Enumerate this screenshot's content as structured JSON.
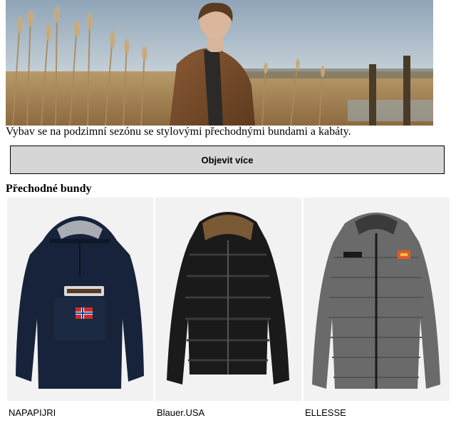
{
  "hero": {
    "image": "hero-photo-man-in-shearling-coat-in-reeds",
    "text": "Vybav se na podzimní sezónu se stylovými přechodnými bundami a kabáty."
  },
  "cta": {
    "label": "Objevit více"
  },
  "section": {
    "title": "Přechodné bundy"
  },
  "products": [
    {
      "brand": "NAPAPIJRI",
      "image": "navy-anorak-jacket"
    },
    {
      "brand": "Blauer.USA",
      "image": "black-puffer-jacket"
    },
    {
      "brand": "ELLESSE",
      "image": "grey-puffer-jacket"
    }
  ]
}
